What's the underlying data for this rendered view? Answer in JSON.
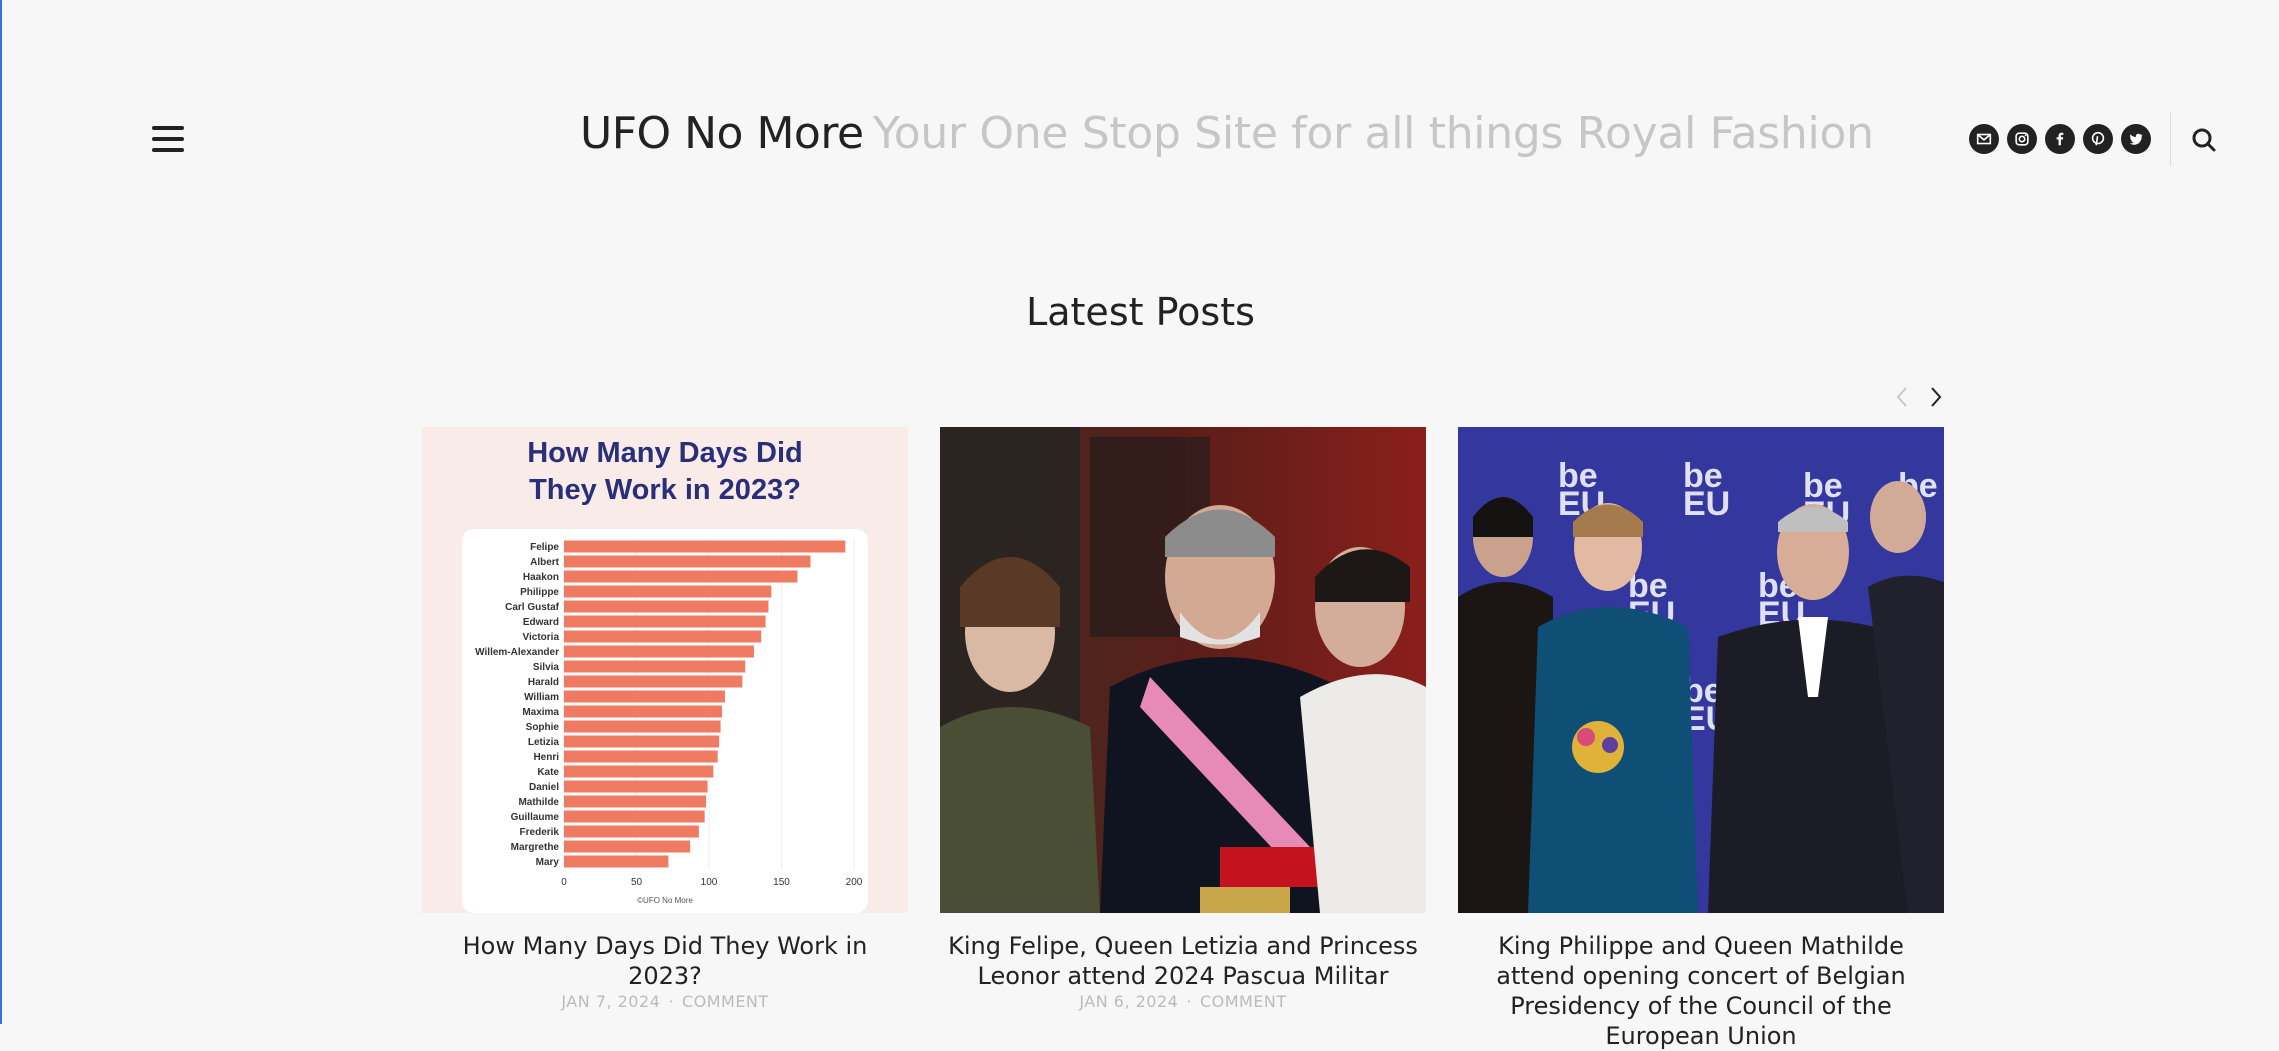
{
  "header": {
    "site_title": "UFO No More",
    "tagline": "Your One Stop Site for all things Royal Fashion",
    "socials": [
      {
        "name": "mail-icon"
      },
      {
        "name": "instagram-icon"
      },
      {
        "name": "facebook-icon"
      },
      {
        "name": "pinterest-icon"
      },
      {
        "name": "twitter-icon"
      }
    ]
  },
  "section": {
    "title": "Latest Posts"
  },
  "posts": [
    {
      "title": "How Many Days Did They Work in 2023?",
      "date": "JAN 7, 2024",
      "comment": "COMMENT"
    },
    {
      "title": "King Felipe, Queen Letizia and Princess Leonor attend 2024 Pascua Militar",
      "date": "JAN 6, 2024",
      "comment": "COMMENT"
    },
    {
      "title": "King Philippe and Queen Mathilde attend opening concert of Belgian Presidency of the Council of the European Union",
      "date": "",
      "comment": ""
    }
  ],
  "thumb_chart": {
    "heading_line1": "How Many Days Did",
    "heading_line2": "They Work in 2023?",
    "credit": "©UFO No More",
    "chart_data": {
      "type": "bar",
      "orientation": "horizontal",
      "categories": [
        "Felipe",
        "Albert",
        "Haakon",
        "Philippe",
        "Carl Gustaf",
        "Edward",
        "Victoria",
        "Willem-Alexander",
        "Silvia",
        "Harald",
        "William",
        "Maxima",
        "Sophie",
        "Letizia",
        "Henri",
        "Kate",
        "Daniel",
        "Mathilde",
        "Guillaume",
        "Frederik",
        "Margrethe",
        "Mary"
      ],
      "values": [
        194,
        170,
        161,
        143,
        141,
        139,
        136,
        131,
        125,
        123,
        111,
        109,
        108,
        107,
        106,
        103,
        99,
        98,
        97,
        93,
        87,
        72
      ],
      "xlim": [
        0,
        200
      ],
      "xticks": [
        "0",
        "50",
        "100",
        "150",
        "200"
      ],
      "color": "#ef7b63"
    }
  },
  "colors": {
    "background": "#f7f7f7",
    "tagline": "#c6c6c6",
    "meta": "#bbbbbb",
    "chart_heading": "#2a2f7a"
  }
}
